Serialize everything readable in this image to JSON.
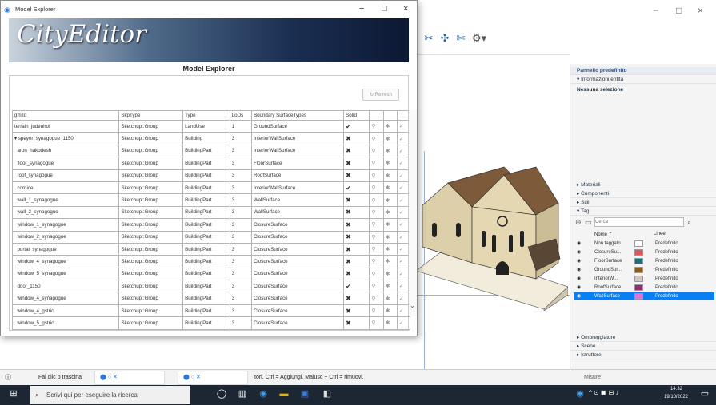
{
  "sketchup": {
    "toolbar_icons": [
      "ruler-icon",
      "pipe-icon",
      "pipe-alt-icon",
      "globe-icon"
    ],
    "window_controls": [
      "−",
      "□",
      "×"
    ],
    "tray": {
      "title": "Pannello predefinito",
      "entity_info": "▾ Informazioni entità",
      "no_selection": "Nessuna selezione",
      "sections_top": [
        "▸ Materiali",
        "▸ Componenti",
        "▸ Stili",
        "▾ Tag"
      ],
      "tag_search_placeholder": "Cerca",
      "columns": {
        "name": "Nome",
        "dashes": "Linee"
      },
      "tags": [
        {
          "name": "Non taggato",
          "color": "#ffffff",
          "dash": "Predefinito"
        },
        {
          "name": "ClosureSu...",
          "color": "#d6595d",
          "dash": "Predefinito"
        },
        {
          "name": "FloorSurface",
          "color": "#1f6f78",
          "dash": "Predefinito"
        },
        {
          "name": "GroundSur...",
          "color": "#8a5a1e",
          "dash": "Predefinito"
        },
        {
          "name": "InteriorW...",
          "color": "#cfc9c1",
          "dash": "Predefinito"
        },
        {
          "name": "RoofSurface",
          "color": "#8f2f6b",
          "dash": "Predefinito"
        },
        {
          "name": "WallSurface",
          "color": "#e86fd8",
          "dash": "Predefinito"
        }
      ],
      "sections_bottom": [
        "▸ Ombreggiature",
        "▸ Scene",
        "▸ Istruttore"
      ]
    },
    "status": {
      "left": "Fai clic o trascina",
      "hint": "tori. Ctrl = Aggiungi. Maiusc + Ctrl = rimuovi.",
      "measure": "Misure"
    }
  },
  "taskbar": {
    "search_placeholder": "Scrivi qui per eseguire la ricerca",
    "time": "14:32",
    "date": "19/10/2022"
  },
  "explorer": {
    "window_title": "Model Explorer",
    "logo": "CityEditor",
    "header": "Model Explorer",
    "refresh": "↻ Refresh",
    "columns": [
      "gmlId",
      "SkpType",
      "Type",
      "LoDs",
      "Boundary SurfaceTypes",
      "Solid"
    ],
    "rows": [
      {
        "gml": "terrain_judenhof",
        "skp": "Sketchup::Group",
        "type": "LandUse",
        "lod": "1",
        "bs": "GroundSurface",
        "solid": "✔"
      },
      {
        "gml": "▾ speyer_synagogue_1150",
        "skp": "Sketchup::Group",
        "type": "Building",
        "lod": "3",
        "bs": "InteriorWallSurface",
        "solid": "✖"
      },
      {
        "gml": "  aron_hakodesh",
        "skp": "Sketchup::Group",
        "type": "BuildingPart",
        "lod": "3",
        "bs": "InteriorWallSurface",
        "solid": "✖"
      },
      {
        "gml": "  floor_synagogue",
        "skp": "Sketchup::Group",
        "type": "BuildingPart",
        "lod": "3",
        "bs": "FloorSurface",
        "solid": "✖"
      },
      {
        "gml": "  roof_synagogue",
        "skp": "Sketchup::Group",
        "type": "BuildingPart",
        "lod": "3",
        "bs": "RoofSurface",
        "solid": "✖"
      },
      {
        "gml": "  cornice",
        "skp": "Sketchup::Group",
        "type": "BuildingPart",
        "lod": "3",
        "bs": "InteriorWallSurface",
        "solid": "✔"
      },
      {
        "gml": "  wall_1_synagogue",
        "skp": "Sketchup::Group",
        "type": "BuildingPart",
        "lod": "3",
        "bs": "WallSurface",
        "solid": "✖"
      },
      {
        "gml": "  wall_2_synagogue",
        "skp": "Sketchup::Group",
        "type": "BuildingPart",
        "lod": "3",
        "bs": "WallSurface",
        "solid": "✖"
      },
      {
        "gml": "  window_1_synagogue",
        "skp": "Sketchup::Group",
        "type": "BuildingPart",
        "lod": "3",
        "bs": "ClosureSurface",
        "solid": "✖"
      },
      {
        "gml": "  window_2_synagogue",
        "skp": "Sketchup::Group",
        "type": "BuildingPart",
        "lod": "3",
        "bs": "ClosureSurface",
        "solid": "✖"
      },
      {
        "gml": "  portal_synagogue",
        "skp": "Sketchup::Group",
        "type": "BuildingPart",
        "lod": "3",
        "bs": "ClosureSurface",
        "solid": "✖"
      },
      {
        "gml": "  window_4_synagogue",
        "skp": "Sketchup::Group",
        "type": "BuildingPart",
        "lod": "3",
        "bs": "ClosureSurface",
        "solid": "✖"
      },
      {
        "gml": "  window_5_synagogue",
        "skp": "Sketchup::Group",
        "type": "BuildingPart",
        "lod": "3",
        "bs": "ClosureSurface",
        "solid": "✖"
      },
      {
        "gml": "  door_1150",
        "skp": "Sketchup::Group",
        "type": "BuildingPart",
        "lod": "3",
        "bs": "ClosureSurface",
        "solid": "✔"
      },
      {
        "gml": "  window_4_synagogue",
        "skp": "Sketchup::Group",
        "type": "BuildingPart",
        "lod": "3",
        "bs": "ClosureSurface",
        "solid": "✖"
      },
      {
        "gml": "  window_4_gstric",
        "skp": "Sketchup::Group",
        "type": "BuildingPart",
        "lod": "3",
        "bs": "ClosureSurface",
        "solid": "✖"
      },
      {
        "gml": "  window_5_gstric",
        "skp": "Sketchup::Group",
        "type": "BuildingPart",
        "lod": "3",
        "bs": "ClosureSurface",
        "solid": "✖"
      }
    ]
  }
}
